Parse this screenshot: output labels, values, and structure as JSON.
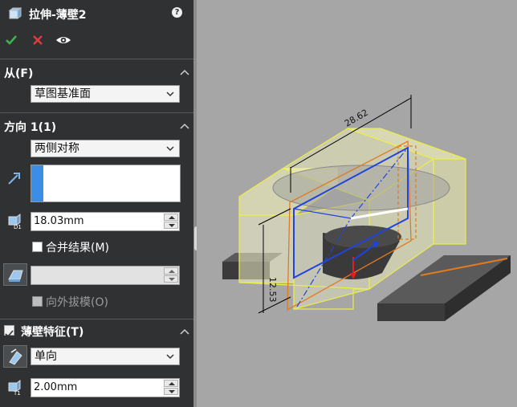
{
  "header": {
    "title": "拉伸-薄壁2",
    "help_icon": "?"
  },
  "toolbar": {
    "ok_icon": "checkmark-icon",
    "cancel_icon": "x-icon",
    "preview_icon": "eye-icon"
  },
  "from": {
    "title": "从(F)",
    "value": "草图基准面"
  },
  "direction1": {
    "title": "方向 1(1)",
    "end_condition": "两侧对称",
    "depth": "18.03mm",
    "merge_label": "合并结果(M)",
    "draft_outward_label": "向外拔模(O)",
    "draft_value": ""
  },
  "thin": {
    "title": "薄壁特征(T)",
    "type": "单向",
    "thickness": "2.00mm"
  },
  "model": {
    "dim_top": "28.62",
    "dim_side": "12.53"
  },
  "colors": {
    "accent": "#3a8ee6",
    "panel": "#2f3133",
    "viewport": "#a6a6a6",
    "ok": "#3fb34f",
    "cancel": "#e03c3c"
  }
}
